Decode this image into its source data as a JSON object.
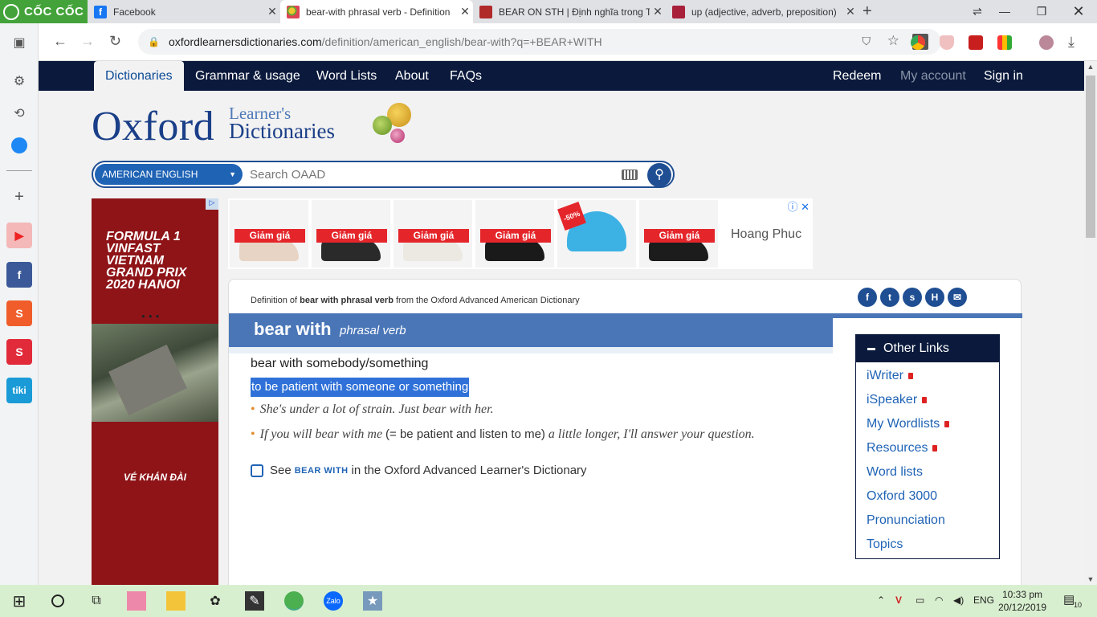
{
  "browser": {
    "brand": "CỐC CỐC",
    "tabs": [
      {
        "title": "Facebook",
        "color": "#1877f2"
      },
      {
        "title": "bear-with phrasal verb - Definition",
        "color": "#4a76b8",
        "active": true
      },
      {
        "title": "BEAR ON STH | Định nghĩa trong T",
        "color": "#b02a2a"
      },
      {
        "title": "up (adjective, adverb, preposition)",
        "color": "#a8203a"
      }
    ],
    "url_host": "oxfordlearnersdictionaries.com",
    "url_path": "/definition/american_english/bear-with?q=+BEAR+WITH"
  },
  "site": {
    "nav": {
      "dictionaries": "Dictionaries",
      "grammar": "Grammar & usage",
      "wordlists": "Word Lists",
      "about": "About",
      "faqs": "FAQs",
      "redeem": "Redeem",
      "myaccount": "My account",
      "signin": "Sign in"
    },
    "logo": {
      "oxford": "Oxford",
      "learners": "Learner's",
      "dictionaries": "Dictionaries"
    },
    "search": {
      "language": "AMERICAN ENGLISH",
      "placeholder": "Search OAAD"
    }
  },
  "ads": {
    "left_title": "FORMULA 1 VINFAST VIETNAM GRAND PRIX 2020 HANOI",
    "left_cta": "VÉ KHÁN ĐÀI",
    "sale_label": "Giảm giá",
    "discount": "-50%",
    "advertiser": "Hoang Phuc"
  },
  "entry": {
    "definition_of_prefix": "Definition of",
    "definition_of_word": "bear with phrasal verb",
    "definition_of_suffix": "from the Oxford Advanced American Dictionary",
    "headword": "bear with",
    "pos": "phrasal verb",
    "sense": "bear with somebody/something",
    "definition": "to be patient with someone or something",
    "ex1": "She's under a lot of strain. Just bear with her.",
    "ex2_a": "If you will bear with me",
    "ex2_gloss": "(= be patient and listen to me)",
    "ex2_b": "a little longer, I'll answer your question.",
    "see_prefix": "See",
    "see_link": "BEAR WITH",
    "see_suffix": "in the Oxford Advanced Learner's Dictionary"
  },
  "other_links": {
    "title": "Other Links",
    "items": [
      "iWriter",
      "iSpeaker",
      "My Wordlists",
      "Resources",
      "Word lists",
      "Oxford 3000",
      "Pronunciation",
      "Topics"
    ]
  },
  "taskbar": {
    "lang": "ENG",
    "time": "10:33 pm",
    "date": "20/12/2019",
    "notifications": "10"
  }
}
